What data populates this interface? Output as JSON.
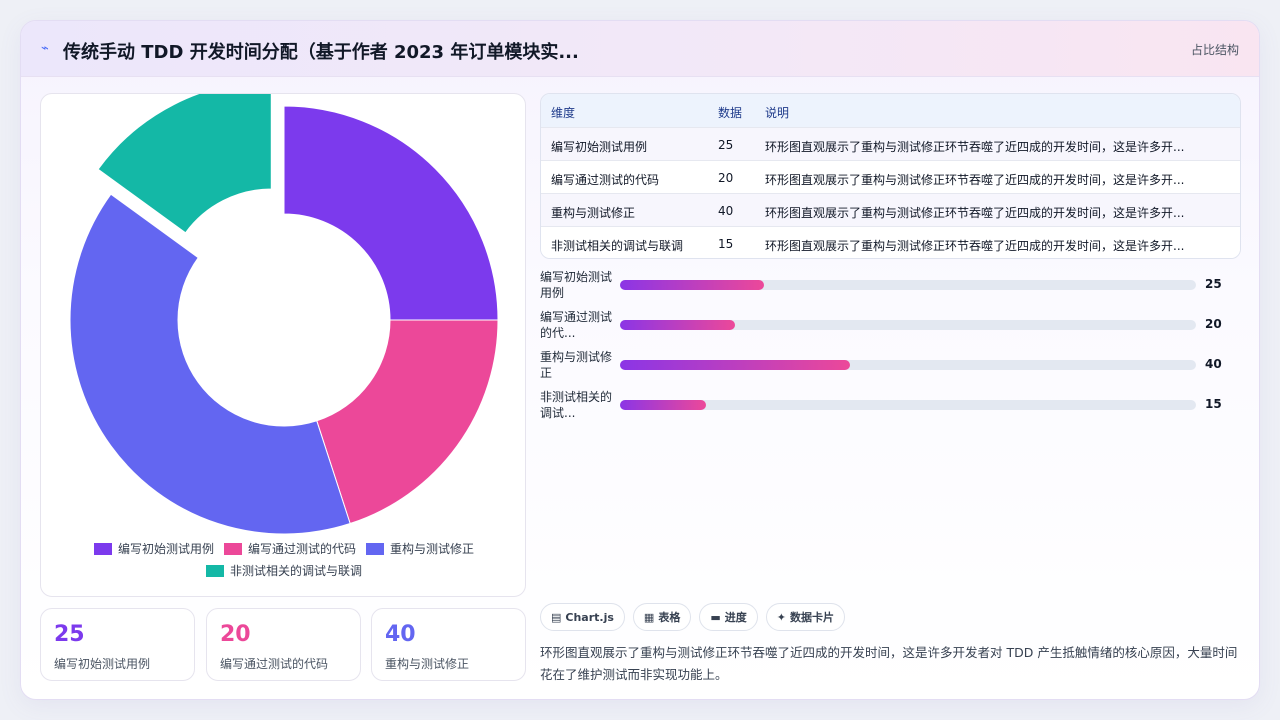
{
  "header": {
    "icon": "chart-line-icon",
    "title": "传统手动 TDD 开发时间分配（基于作者 2023 年订单模块实...",
    "tag": "占比结构"
  },
  "colors": {
    "purple": "#7c3aed",
    "pink": "#ec4899",
    "indigo": "#6366f1",
    "teal": "#14b8a6"
  },
  "chart_data": {
    "type": "pie",
    "variant": "doughnut",
    "categories": [
      "编写初始测试用例",
      "编写通过测试的代码",
      "重构与测试修正",
      "非测试相关的调试与联调"
    ],
    "values": [
      25,
      20,
      40,
      15
    ],
    "colors": [
      "#7c3aed",
      "#ec4899",
      "#6366f1",
      "#14b8a6"
    ],
    "legend_position": "bottom"
  },
  "stats": [
    {
      "value": "25",
      "label": "编写初始测试用例",
      "color": "#7c3aed"
    },
    {
      "value": "20",
      "label": "编写通过测试的代码",
      "color": "#ec4899"
    },
    {
      "value": "40",
      "label": "重构与测试修正",
      "color": "#6366f1"
    }
  ],
  "table": {
    "headers": [
      "维度",
      "数据",
      "说明"
    ],
    "rows": [
      [
        "编写初始测试用例",
        "25",
        "环形图直观展示了重构与测试修正环节吞噬了近四成的开发时间，这是许多开..."
      ],
      [
        "编写通过测试的代码",
        "20",
        "环形图直观展示了重构与测试修正环节吞噬了近四成的开发时间，这是许多开..."
      ],
      [
        "重构与测试修正",
        "40",
        "环形图直观展示了重构与测试修正环节吞噬了近四成的开发时间，这是许多开..."
      ],
      [
        "非测试相关的调试与联调",
        "15",
        "环形图直观展示了重构与测试修正环节吞噬了近四成的开发时间，这是许多开..."
      ]
    ]
  },
  "bars": [
    {
      "label": "编写初始测试用例",
      "value": 25,
      "value_text": "25"
    },
    {
      "label": "编写通过测试的代...",
      "value": 20,
      "value_text": "20"
    },
    {
      "label": "重构与测试修正",
      "value": 40,
      "value_text": "40"
    },
    {
      "label": "非测试相关的调试...",
      "value": 15,
      "value_text": "15"
    }
  ],
  "chips": [
    {
      "icon": "chart-icon",
      "glyph": "▤",
      "label": "Chart.js"
    },
    {
      "icon": "table-icon",
      "glyph": "▦",
      "label": "表格"
    },
    {
      "icon": "progress-icon",
      "glyph": "▬",
      "label": "进度"
    },
    {
      "icon": "sparkle-icon",
      "glyph": "✦",
      "label": "数据卡片"
    }
  ],
  "description": "环形图直观展示了重构与测试修正环节吞噬了近四成的开发时间，这是许多开发者对 TDD 产生抵触情绪的核心原因，大量时间花在了维护测试而非实现功能上。"
}
